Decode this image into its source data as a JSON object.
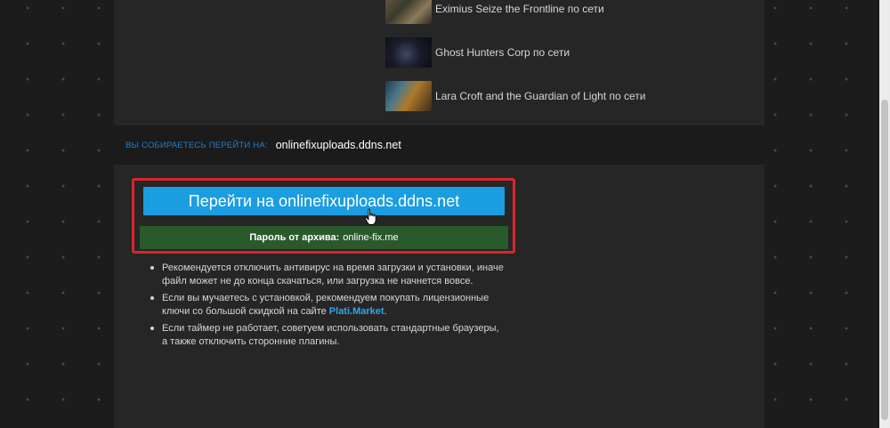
{
  "related_games": [
    {
      "title": "Eximius Seize the Frontline по сети",
      "thumb": "eximius-thumbnail"
    },
    {
      "title": "Ghost Hunters Corp по сети",
      "thumb": "ghost-hunters-thumbnail"
    },
    {
      "title": "Lara Croft and the Guardian of Light по сети",
      "thumb": "lara-croft-thumbnail"
    }
  ],
  "redirect": {
    "label": "ВЫ СОБИРАЕТЕСЬ ПЕРЕЙТИ НА:",
    "host": "onlinefixuploads.ddns.net"
  },
  "go_button": {
    "label": "Перейти на onlinefixuploads.ddns.net"
  },
  "password": {
    "label": "Пароль от архива:",
    "value": "online-fix.me"
  },
  "tips": [
    "Рекомендуется отключить антивирус на время загрузки и установки, иначе файл может не до конца скачаться, или загрузка не начнется вовсе.",
    {
      "before": "Если вы мучаетесь с установкой, рекомендуем покупать лицензионные ключи со большой скидкой на сайте ",
      "link": "Plati.Market",
      "after": "."
    },
    "Если таймер не работает, советуем использовать стандартные браузеры, а также отключить сторонние плагины."
  ],
  "colors": {
    "button": "#1b9de1",
    "password_bar": "#2a5a2c",
    "highlight": "#d9252b",
    "accent_label": "#1f7fcf"
  },
  "icons": {
    "cursor": "hand-pointer-icon"
  }
}
